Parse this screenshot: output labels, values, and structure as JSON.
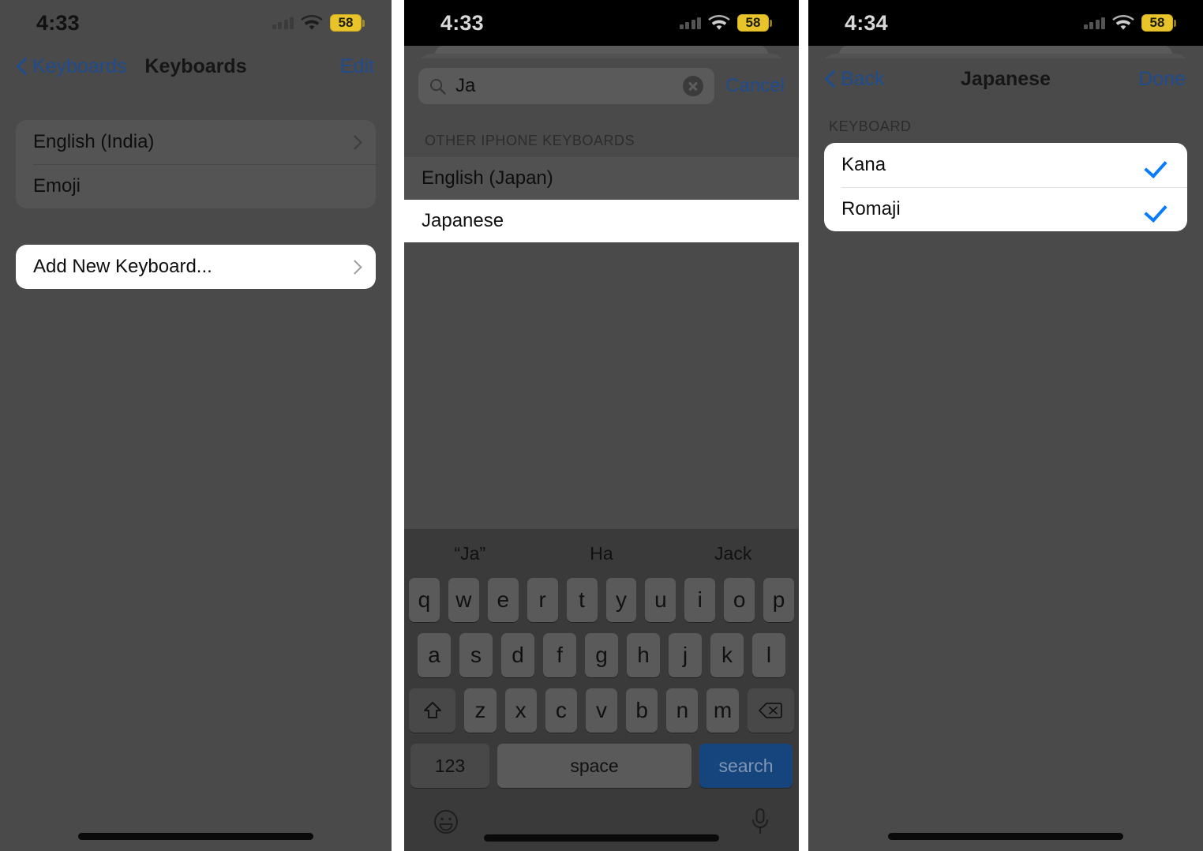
{
  "panels": [
    {
      "id": "keyboards-list",
      "status_bar": {
        "time": "4:33",
        "battery": "58",
        "wifi_icon": "wifi-icon",
        "cellular_icon": "cellular-bars-icon"
      },
      "nav": {
        "back_label": "Keyboards",
        "title": "Keyboards",
        "action_label": "Edit"
      },
      "keyboard_rows": [
        {
          "label": "English (India)",
          "accessory": "chevron-right-icon"
        },
        {
          "label": "Emoji",
          "accessory": ""
        }
      ],
      "add_row": {
        "label": "Add New Keyboard...",
        "accessory": "chevron-right-icon"
      }
    },
    {
      "id": "add-keyboard-search",
      "status_bar": {
        "time": "4:33",
        "battery": "58",
        "wifi_icon": "wifi-icon",
        "cellular_icon": "cellular-bars-icon"
      },
      "search": {
        "value": "Ja",
        "placeholder": "Search",
        "icon": "search-icon",
        "clear_icon": "clear-circle-icon",
        "cancel_label": "Cancel"
      },
      "section_header": "OTHER IPHONE KEYBOARDS",
      "results": [
        {
          "label": "English (Japan)",
          "selected": false
        },
        {
          "label": "Japanese",
          "selected": true
        }
      ],
      "keyboard": {
        "predictions": [
          "“Ja”",
          "Ha",
          "Jack"
        ],
        "row1": [
          "q",
          "w",
          "e",
          "r",
          "t",
          "y",
          "u",
          "i",
          "o",
          "p"
        ],
        "row2": [
          "a",
          "s",
          "d",
          "f",
          "g",
          "h",
          "j",
          "k",
          "l"
        ],
        "row3": [
          "z",
          "x",
          "c",
          "v",
          "b",
          "n",
          "m"
        ],
        "shift_label": "shift-key",
        "delete_label": "delete-key",
        "numbers_label": "123",
        "space_label": "space",
        "return_label": "search",
        "emoji_label": "emoji-key",
        "dictation_label": "dictation-key"
      }
    },
    {
      "id": "japanese-options",
      "status_bar": {
        "time": "4:34",
        "battery": "58",
        "wifi_icon": "wifi-icon",
        "cellular_icon": "cellular-bars-icon"
      },
      "nav": {
        "back_label": "Back",
        "title": "Japanese",
        "action_label": "Done"
      },
      "section_header": "KEYBOARD",
      "options": [
        {
          "label": "Kana",
          "checked": true
        },
        {
          "label": "Romaji",
          "checked": true
        }
      ]
    }
  ],
  "colors": {
    "accent_blue": "#0a7cff",
    "nav_blue": "#1f4c8f",
    "battery_yellow": "#e8c32a",
    "dim_background": "#4a4a4a",
    "keyboard_background": "#3a3a3a",
    "return_key_blue": "#16447c"
  }
}
